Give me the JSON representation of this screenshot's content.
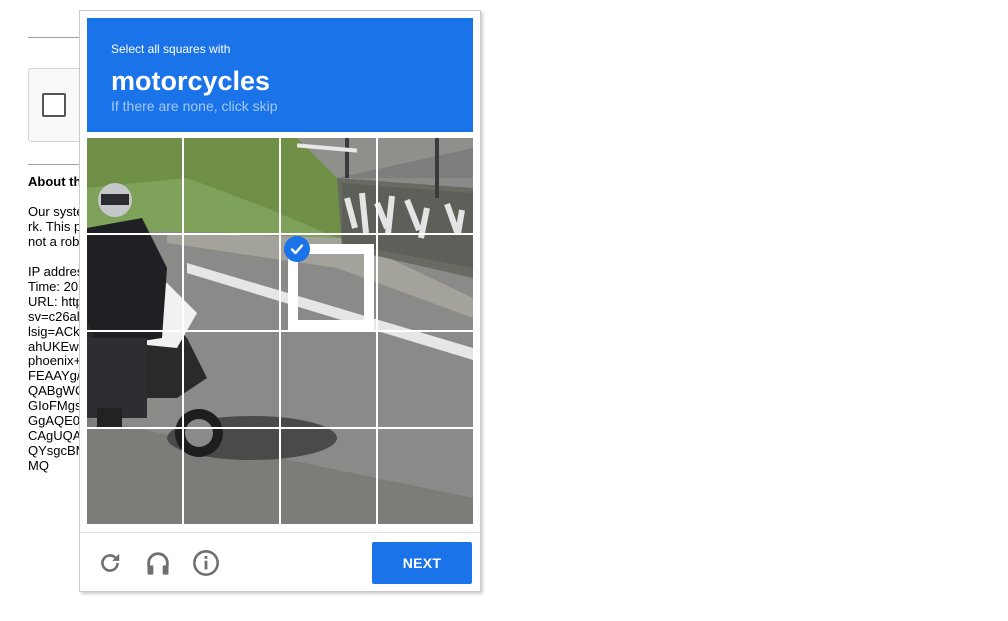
{
  "background_page": {
    "about_heading": "About th",
    "paragraph_lines": [
      "Our syste",
      "rk. This p",
      "not a rob"
    ],
    "info_lines": [
      "IP addres",
      "Time: 20",
      "URL: http",
      "sv=c26al",
      "lsig=ACk",
      "ahUKEw",
      "phoenix+",
      "FEAAYg/",
      "QABgWC",
      "GIoFMgs",
      "GgAQE0",
      "CAgUQA",
      "QYsgcBM",
      "MQ"
    ]
  },
  "challenge": {
    "instruction": "Select all squares with",
    "target": "motorcycles",
    "hint": "If there are none, click skip",
    "grid_rows": 4,
    "grid_cols": 4,
    "selected_tiles": [
      6
    ],
    "next_label": "NEXT",
    "colors": {
      "accent": "#1a73e8",
      "icon_gray": "#6f6f6f"
    }
  },
  "icons": [
    "reload-icon",
    "audio-icon",
    "info-icon",
    "checkmark-icon"
  ]
}
